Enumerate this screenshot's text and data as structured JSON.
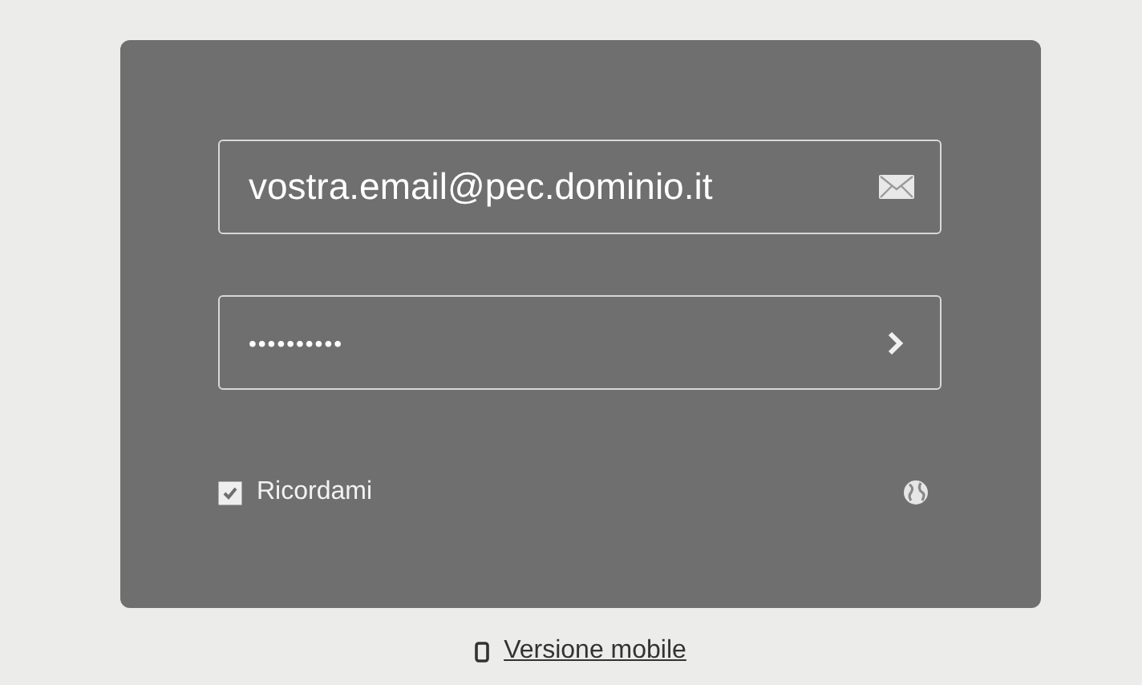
{
  "login": {
    "email": {
      "value": "vostra.email@pec.dominio.it"
    },
    "password": {
      "masked_value": "••••••••••"
    },
    "remember": {
      "label": "Ricordami",
      "checked": true
    }
  },
  "footer_link": {
    "label": "Versione mobile"
  }
}
